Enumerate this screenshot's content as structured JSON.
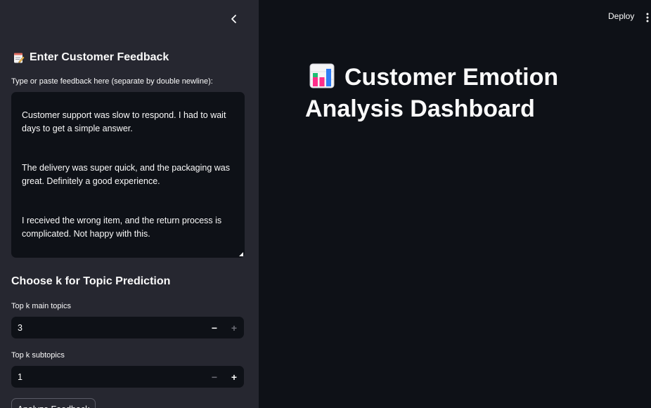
{
  "sidebar": {
    "header": "Enter Customer Feedback",
    "feedback_label": "Type or paste feedback here (separate by double newline):",
    "feedback_paragraphs": [
      "Customer support was slow to respond. I had to wait days to get a simple answer.",
      "The delivery was super quick, and the packaging was great. Definitely a good experience.",
      "I received the wrong item, and the return process is complicated. Not happy with this."
    ],
    "section_title": "Choose k for Topic Prediction",
    "main_topics": {
      "label": "Top k main topics",
      "value": "3"
    },
    "subtopics": {
      "label": "Top k subtopics",
      "value": "1"
    },
    "analyze_button": "Analyze Feedback"
  },
  "header": {
    "deploy_label": "Deploy"
  },
  "main": {
    "title": "Customer Emotion Analysis Dashboard"
  },
  "icons": {
    "collapse": "chevron-left-icon",
    "memo": "memo-icon",
    "title": "bar-chart-icon",
    "menu": "kebab-menu-icon"
  },
  "colors": {
    "sidebar_bg": "#262730",
    "main_bg": "#0e1117",
    "text": "#fafafa"
  }
}
